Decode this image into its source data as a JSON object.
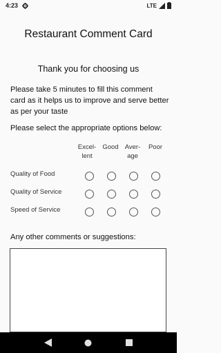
{
  "status_bar": {
    "time": "4:23",
    "network": "LTE"
  },
  "card": {
    "title": "Restaurant Comment Card",
    "thanks": "Thank you for choosing us",
    "intro": "Please take 5 minutes to fill this comment card as it helps us to improve and serve better as per your taste",
    "instruction": "Please select the appropriate options below:",
    "columns": [
      {
        "line1": "Excel-",
        "line2": "lent"
      },
      {
        "line1": "Good",
        "line2": ""
      },
      {
        "line1": "Aver-",
        "line2": "age"
      },
      {
        "line1": "Poor",
        "line2": ""
      }
    ],
    "rows": [
      {
        "label": "Quality of Food"
      },
      {
        "label": "Quality of Service"
      },
      {
        "label": "Speed of Service"
      }
    ],
    "comments_label": "Any other comments or suggestions:",
    "comments_value": ""
  },
  "colors": {
    "background": "#fafafa",
    "nav_bar": "#000000",
    "radio_border": "#555555"
  },
  "icons": {
    "status_settings": "gear-icon",
    "signal": "signal-icon",
    "battery": "battery-icon",
    "nav_back": "back-triangle-icon",
    "nav_home": "home-circle-icon",
    "nav_recents": "recents-square-icon"
  }
}
